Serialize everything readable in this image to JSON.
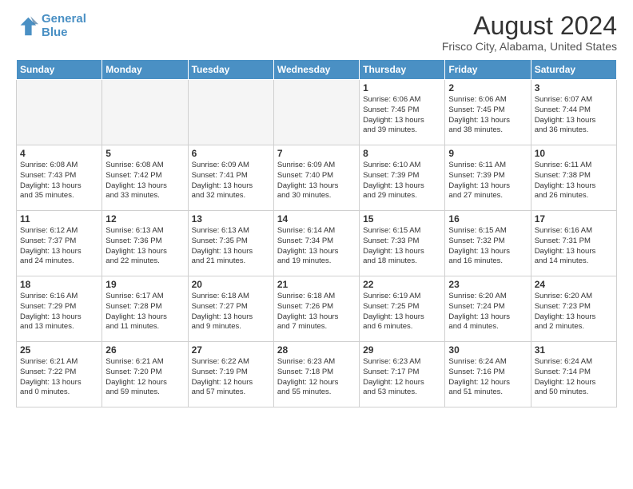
{
  "header": {
    "logo_line1": "General",
    "logo_line2": "Blue",
    "title": "August 2024",
    "subtitle": "Frisco City, Alabama, United States"
  },
  "weekdays": [
    "Sunday",
    "Monday",
    "Tuesday",
    "Wednesday",
    "Thursday",
    "Friday",
    "Saturday"
  ],
  "weeks": [
    [
      {
        "day": "",
        "info": ""
      },
      {
        "day": "",
        "info": ""
      },
      {
        "day": "",
        "info": ""
      },
      {
        "day": "",
        "info": ""
      },
      {
        "day": "1",
        "info": "Sunrise: 6:06 AM\nSunset: 7:45 PM\nDaylight: 13 hours\nand 39 minutes."
      },
      {
        "day": "2",
        "info": "Sunrise: 6:06 AM\nSunset: 7:45 PM\nDaylight: 13 hours\nand 38 minutes."
      },
      {
        "day": "3",
        "info": "Sunrise: 6:07 AM\nSunset: 7:44 PM\nDaylight: 13 hours\nand 36 minutes."
      }
    ],
    [
      {
        "day": "4",
        "info": "Sunrise: 6:08 AM\nSunset: 7:43 PM\nDaylight: 13 hours\nand 35 minutes."
      },
      {
        "day": "5",
        "info": "Sunrise: 6:08 AM\nSunset: 7:42 PM\nDaylight: 13 hours\nand 33 minutes."
      },
      {
        "day": "6",
        "info": "Sunrise: 6:09 AM\nSunset: 7:41 PM\nDaylight: 13 hours\nand 32 minutes."
      },
      {
        "day": "7",
        "info": "Sunrise: 6:09 AM\nSunset: 7:40 PM\nDaylight: 13 hours\nand 30 minutes."
      },
      {
        "day": "8",
        "info": "Sunrise: 6:10 AM\nSunset: 7:39 PM\nDaylight: 13 hours\nand 29 minutes."
      },
      {
        "day": "9",
        "info": "Sunrise: 6:11 AM\nSunset: 7:39 PM\nDaylight: 13 hours\nand 27 minutes."
      },
      {
        "day": "10",
        "info": "Sunrise: 6:11 AM\nSunset: 7:38 PM\nDaylight: 13 hours\nand 26 minutes."
      }
    ],
    [
      {
        "day": "11",
        "info": "Sunrise: 6:12 AM\nSunset: 7:37 PM\nDaylight: 13 hours\nand 24 minutes."
      },
      {
        "day": "12",
        "info": "Sunrise: 6:13 AM\nSunset: 7:36 PM\nDaylight: 13 hours\nand 22 minutes."
      },
      {
        "day": "13",
        "info": "Sunrise: 6:13 AM\nSunset: 7:35 PM\nDaylight: 13 hours\nand 21 minutes."
      },
      {
        "day": "14",
        "info": "Sunrise: 6:14 AM\nSunset: 7:34 PM\nDaylight: 13 hours\nand 19 minutes."
      },
      {
        "day": "15",
        "info": "Sunrise: 6:15 AM\nSunset: 7:33 PM\nDaylight: 13 hours\nand 18 minutes."
      },
      {
        "day": "16",
        "info": "Sunrise: 6:15 AM\nSunset: 7:32 PM\nDaylight: 13 hours\nand 16 minutes."
      },
      {
        "day": "17",
        "info": "Sunrise: 6:16 AM\nSunset: 7:31 PM\nDaylight: 13 hours\nand 14 minutes."
      }
    ],
    [
      {
        "day": "18",
        "info": "Sunrise: 6:16 AM\nSunset: 7:29 PM\nDaylight: 13 hours\nand 13 minutes."
      },
      {
        "day": "19",
        "info": "Sunrise: 6:17 AM\nSunset: 7:28 PM\nDaylight: 13 hours\nand 11 minutes."
      },
      {
        "day": "20",
        "info": "Sunrise: 6:18 AM\nSunset: 7:27 PM\nDaylight: 13 hours\nand 9 minutes."
      },
      {
        "day": "21",
        "info": "Sunrise: 6:18 AM\nSunset: 7:26 PM\nDaylight: 13 hours\nand 7 minutes."
      },
      {
        "day": "22",
        "info": "Sunrise: 6:19 AM\nSunset: 7:25 PM\nDaylight: 13 hours\nand 6 minutes."
      },
      {
        "day": "23",
        "info": "Sunrise: 6:20 AM\nSunset: 7:24 PM\nDaylight: 13 hours\nand 4 minutes."
      },
      {
        "day": "24",
        "info": "Sunrise: 6:20 AM\nSunset: 7:23 PM\nDaylight: 13 hours\nand 2 minutes."
      }
    ],
    [
      {
        "day": "25",
        "info": "Sunrise: 6:21 AM\nSunset: 7:22 PM\nDaylight: 13 hours\nand 0 minutes."
      },
      {
        "day": "26",
        "info": "Sunrise: 6:21 AM\nSunset: 7:20 PM\nDaylight: 12 hours\nand 59 minutes."
      },
      {
        "day": "27",
        "info": "Sunrise: 6:22 AM\nSunset: 7:19 PM\nDaylight: 12 hours\nand 57 minutes."
      },
      {
        "day": "28",
        "info": "Sunrise: 6:23 AM\nSunset: 7:18 PM\nDaylight: 12 hours\nand 55 minutes."
      },
      {
        "day": "29",
        "info": "Sunrise: 6:23 AM\nSunset: 7:17 PM\nDaylight: 12 hours\nand 53 minutes."
      },
      {
        "day": "30",
        "info": "Sunrise: 6:24 AM\nSunset: 7:16 PM\nDaylight: 12 hours\nand 51 minutes."
      },
      {
        "day": "31",
        "info": "Sunrise: 6:24 AM\nSunset: 7:14 PM\nDaylight: 12 hours\nand 50 minutes."
      }
    ]
  ]
}
